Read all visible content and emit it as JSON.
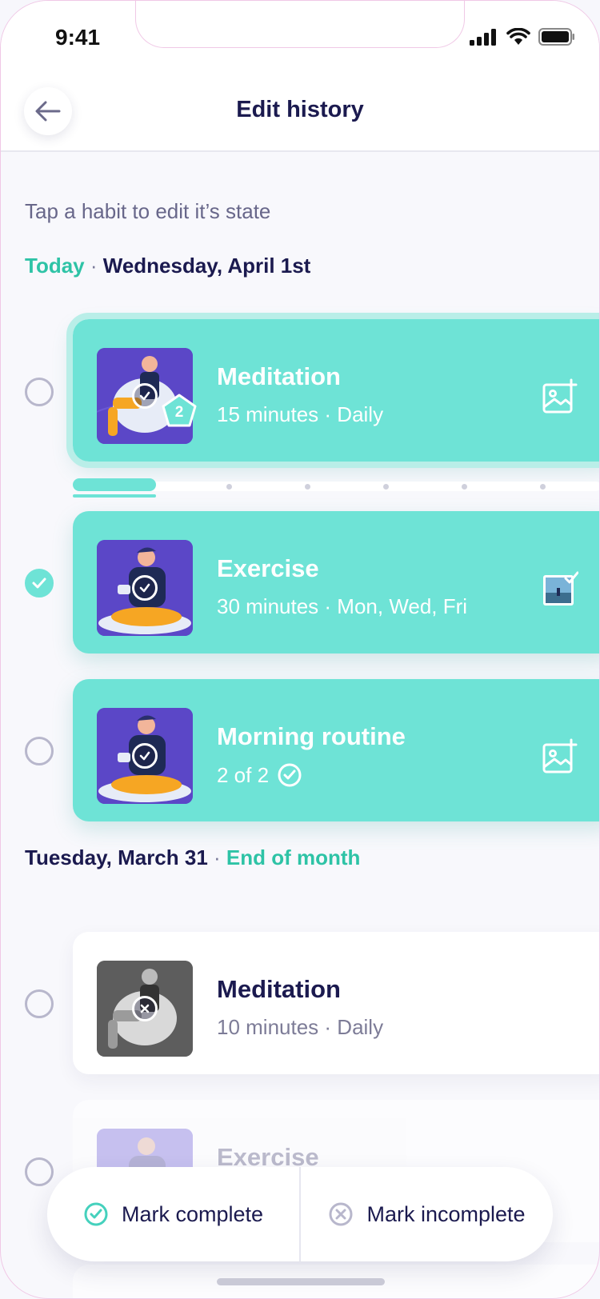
{
  "status": {
    "time": "9:41"
  },
  "header": {
    "title": "Edit history"
  },
  "hint": "Tap a habit to edit it’s state",
  "sections": [
    {
      "label_accent": "Today",
      "separator": " · ",
      "label": "Wednesday, April 1st"
    },
    {
      "label": "Tuesday, March 31",
      "separator": " · ",
      "label_accent": "End of month"
    }
  ],
  "habits": [
    {
      "title": "Meditation",
      "subtitle": "15 minutes · Daily",
      "badge": "2",
      "checked": false
    },
    {
      "title": "Exercise",
      "subtitle": "30 minutes · Mon, Wed, Fri",
      "checked": true
    },
    {
      "title": "Morning routine",
      "subtitle": "2 of 2",
      "checked": false
    },
    {
      "title": "Meditation",
      "subtitle": "10 minutes · Daily",
      "checked": false
    },
    {
      "title": "Exercise",
      "subtitle": "",
      "checked": false
    }
  ],
  "actions": {
    "complete": "Mark complete",
    "incomplete": "Mark incomplete"
  },
  "colors": {
    "accent": "#2ec3a6",
    "card": "#6ee3d6",
    "navy": "#1b1a4f"
  }
}
